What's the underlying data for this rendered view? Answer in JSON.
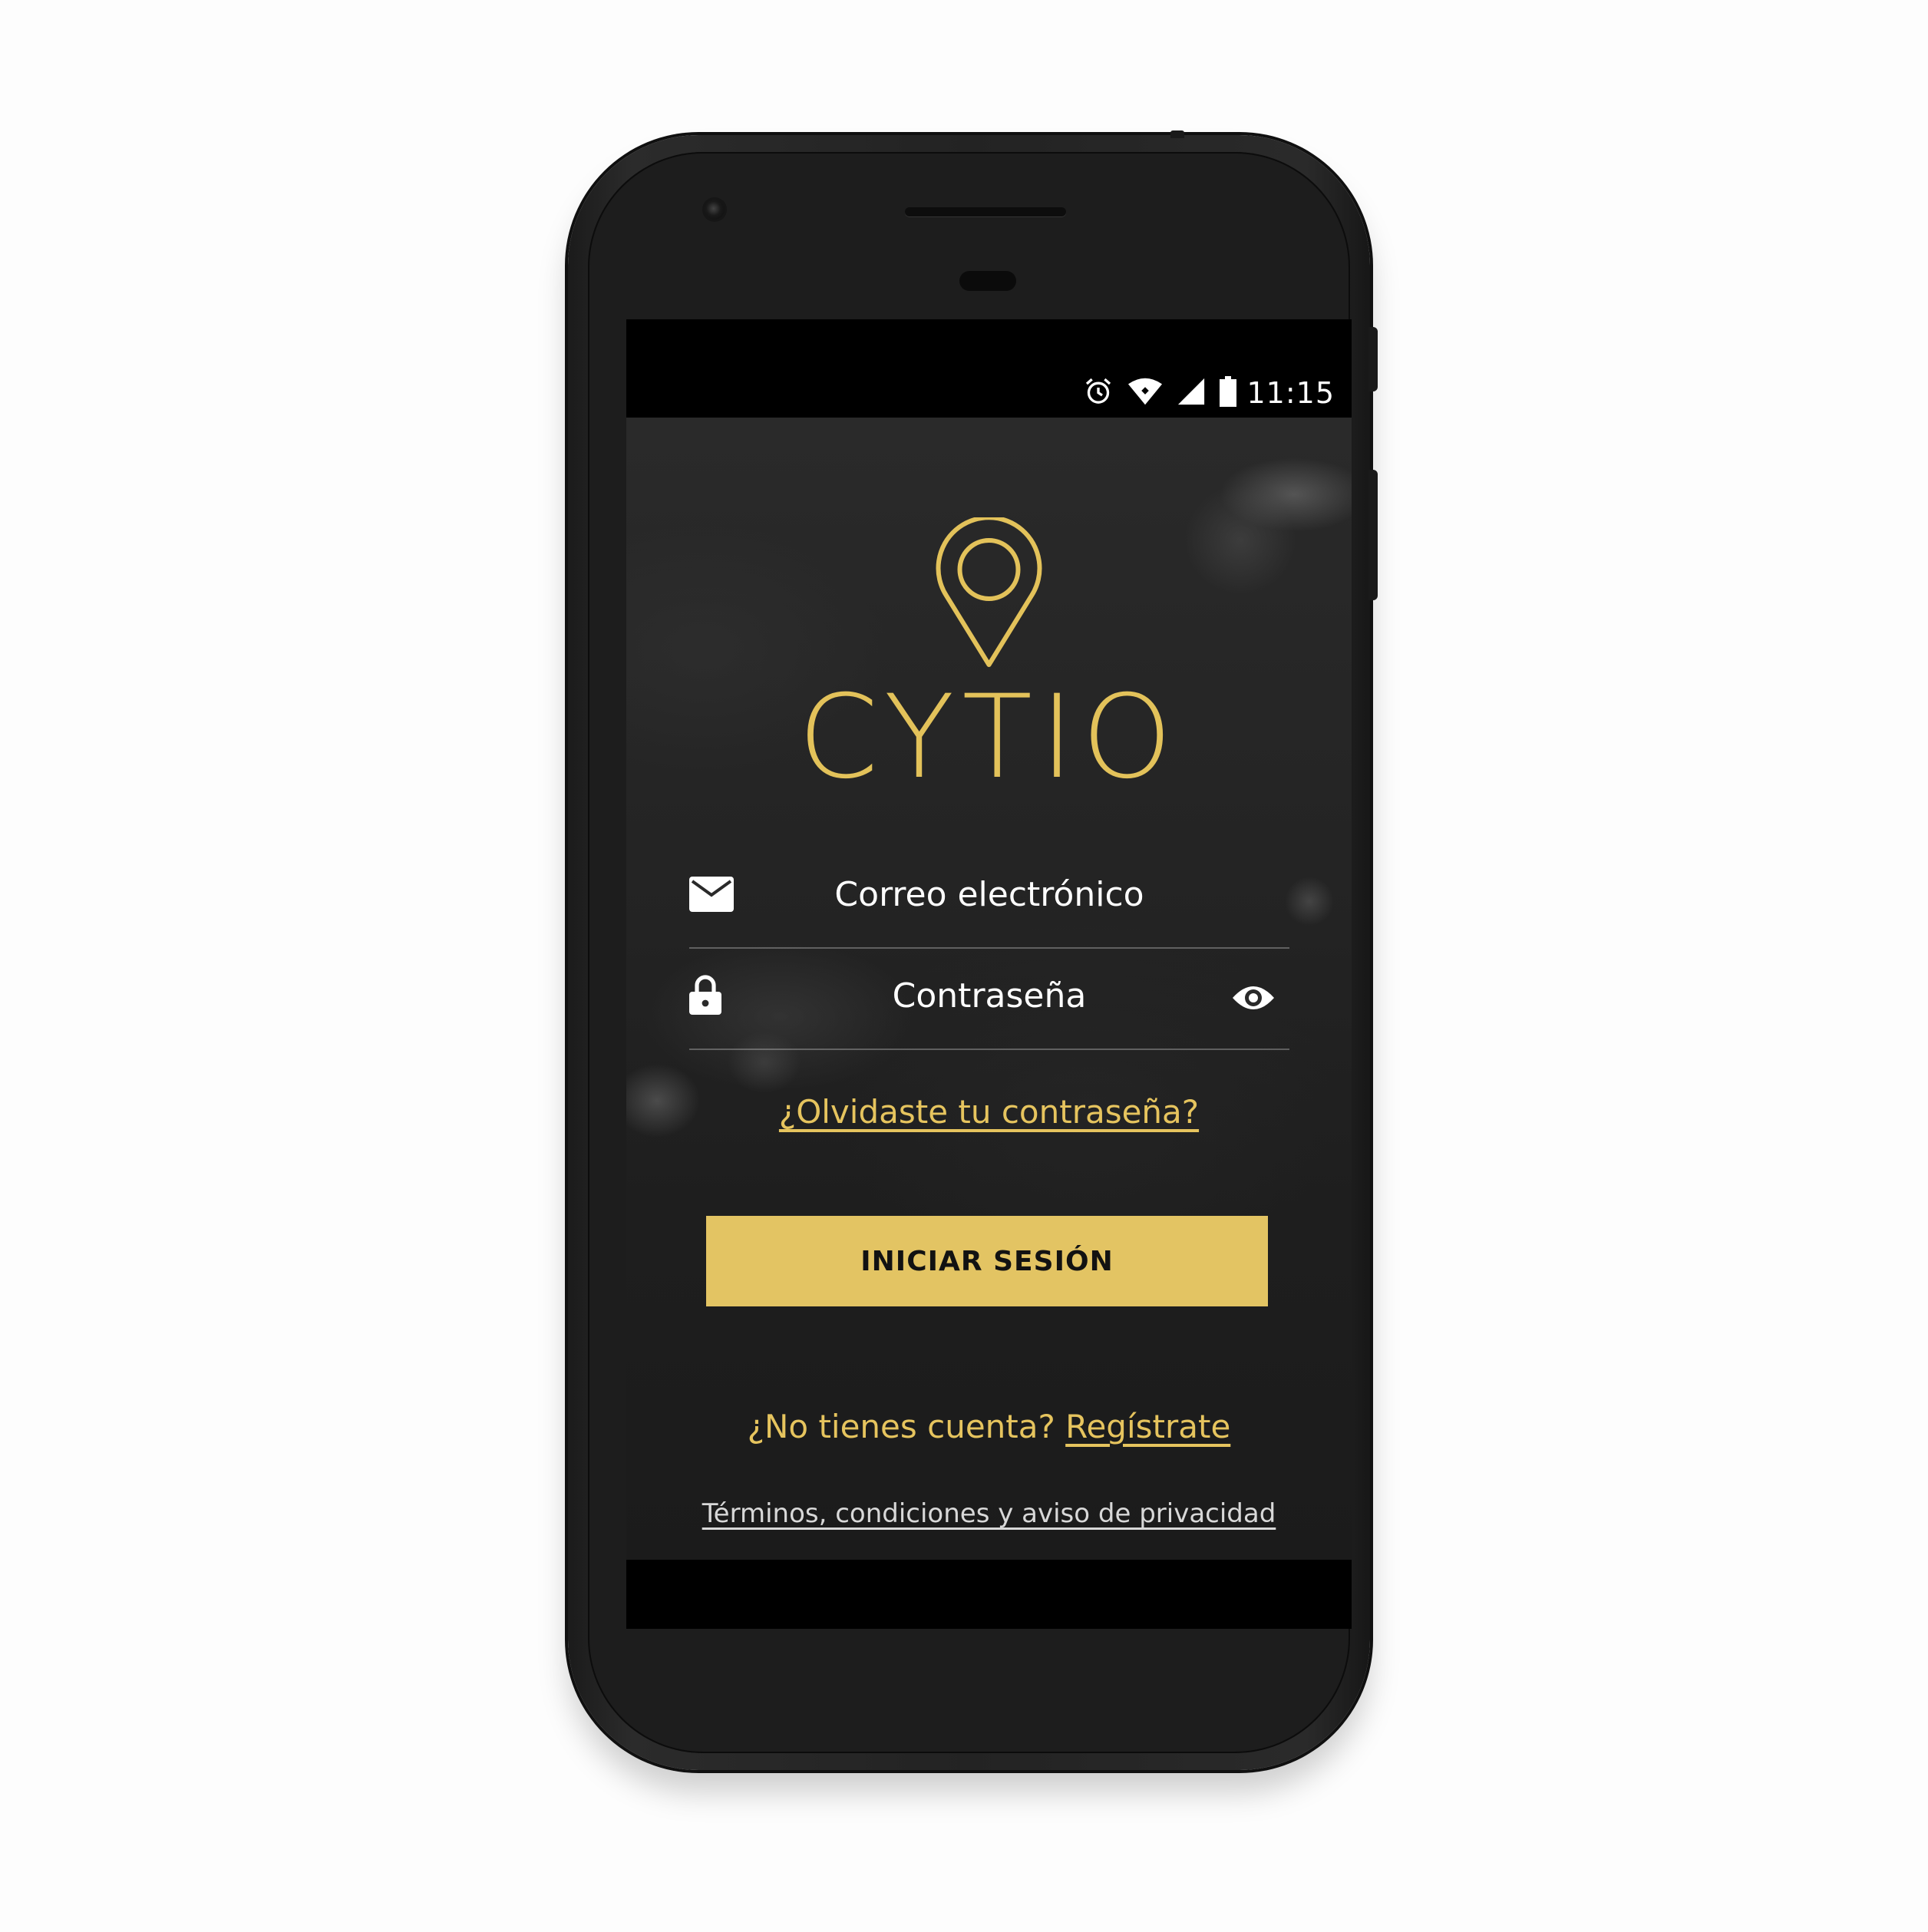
{
  "status_bar": {
    "time": "11:15",
    "icons": [
      "alarm-icon",
      "wifi-icon",
      "signal-icon",
      "battery-icon"
    ]
  },
  "logo": {
    "text": "CYTIO",
    "icon": "location-pin-icon",
    "color": "#e3c25a"
  },
  "form": {
    "email": {
      "placeholder": "Correo electrónico",
      "icon": "mail-icon"
    },
    "password": {
      "placeholder": "Contraseña",
      "icon": "lock-icon",
      "toggle_icon": "eye-icon"
    }
  },
  "forgot_password": "¿Olvidaste tu contraseña?",
  "login_button": "INICIAR SESIÓN",
  "signup": {
    "prompt": "¿No tienes cuenta?",
    "link": "Regístrate"
  },
  "terms": "Términos, condiciones y aviso de privacidad",
  "colors": {
    "accent": "#e3c463",
    "background": "#232323"
  }
}
